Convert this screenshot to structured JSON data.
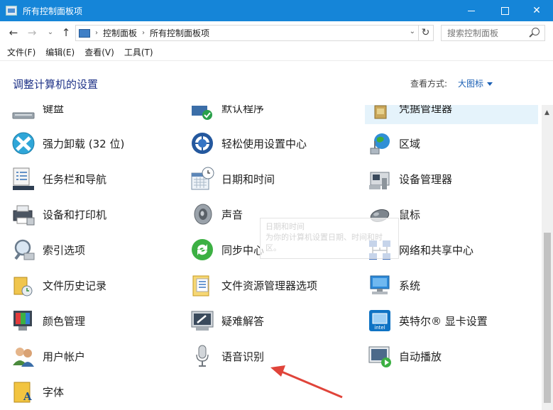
{
  "window": {
    "title": "所有控制面板项",
    "controls": {
      "minimize": "",
      "maximize": "",
      "close": "✕"
    }
  },
  "nav": {
    "back": "←",
    "forward": "→",
    "recent": "⌄",
    "up": "↑",
    "refresh": "↻",
    "breadcrumbs": [
      "控制面板",
      "所有控制面板项"
    ],
    "separator": "›",
    "dropdown": "⌄",
    "search_placeholder": "搜索控制面板"
  },
  "menu": {
    "file": "文件(F)",
    "edit": "编辑(E)",
    "view": "查看(V)",
    "tools": "工具(T)"
  },
  "header": {
    "title": "调整计算机的设置",
    "view_label": "查看方式:",
    "view_value": "大图标"
  },
  "items": [
    {
      "label": "键盘",
      "icon": "keyboard-icon"
    },
    {
      "label": "默认程序",
      "icon": "default-programs-icon"
    },
    {
      "label": "凭据管理器",
      "icon": "credential-manager-icon"
    },
    {
      "label": "强力卸载 (32 位)",
      "icon": "uninstall-icon"
    },
    {
      "label": "轻松使用设置中心",
      "icon": "ease-of-access-icon"
    },
    {
      "label": "区域",
      "icon": "region-globe-icon"
    },
    {
      "label": "任务栏和导航",
      "icon": "taskbar-icon"
    },
    {
      "label": "日期和时间",
      "icon": "calendar-clock-icon"
    },
    {
      "label": "设备管理器",
      "icon": "device-manager-icon"
    },
    {
      "label": "设备和打印机",
      "icon": "printer-icon"
    },
    {
      "label": "声音",
      "icon": "speaker-icon"
    },
    {
      "label": "鼠标",
      "icon": "mouse-icon"
    },
    {
      "label": "索引选项",
      "icon": "magnifier-icon"
    },
    {
      "label": "同步中心",
      "icon": "sync-icon"
    },
    {
      "label": "网络和共享中心",
      "icon": "network-icon"
    },
    {
      "label": "文件历史记录",
      "icon": "file-history-icon"
    },
    {
      "label": "文件资源管理器选项",
      "icon": "folder-options-icon"
    },
    {
      "label": "系统",
      "icon": "system-computer-icon"
    },
    {
      "label": "颜色管理",
      "icon": "color-management-icon"
    },
    {
      "label": "疑难解答",
      "icon": "troubleshooting-icon"
    },
    {
      "label": "英特尔® 显卡设置",
      "icon": "intel-graphics-icon"
    },
    {
      "label": "用户帐户",
      "icon": "user-accounts-icon"
    },
    {
      "label": "语音识别",
      "icon": "microphone-icon"
    },
    {
      "label": "自动播放",
      "icon": "autoplay-icon"
    },
    {
      "label": "字体",
      "icon": "font-icon"
    }
  ],
  "tooltip": {
    "line1": "日期和时间",
    "line2": "为你的计算机设置日期、时间和时区。"
  },
  "scrollbar": {
    "arrow_up": "▲"
  },
  "colors": {
    "titlebar": "#1585d8",
    "accent_link": "#1a5fb4",
    "selection": "#e5f3fb",
    "annotation_arrow": "#e0443a"
  }
}
